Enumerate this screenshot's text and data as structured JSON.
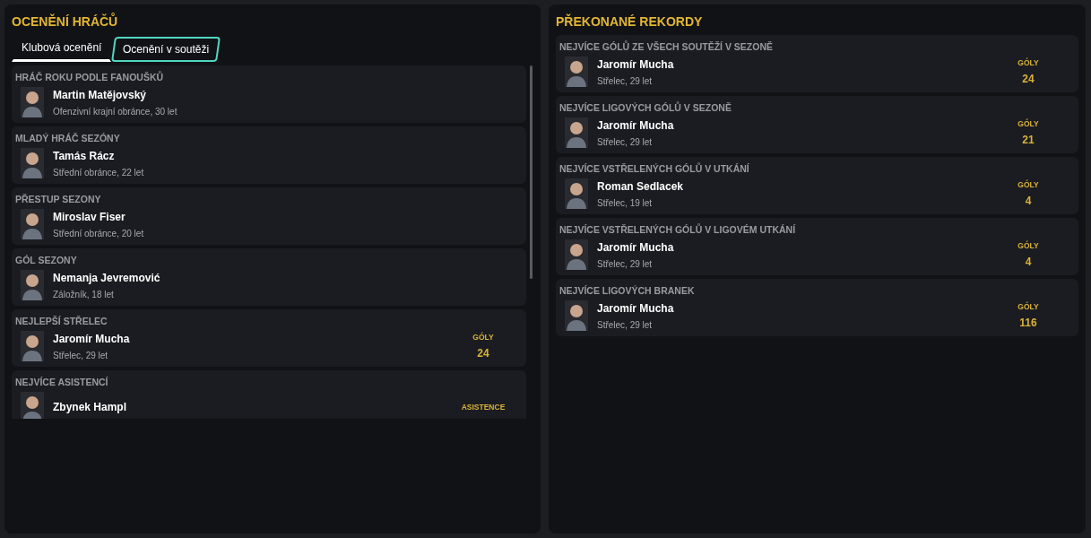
{
  "awards_panel": {
    "title": "OCENĚNÍ HRÁČŮ",
    "tabs": [
      {
        "label": "Klubová ocenění",
        "selected": true,
        "focused": false
      },
      {
        "label": "Ocenění v soutěži",
        "selected": false,
        "focused": true
      }
    ],
    "awards": [
      {
        "title": "HRÁČ ROKU PODLE FANOUŠKŮ",
        "name": "Martin Matějovský",
        "info": "Ofenzivní krajní obránce, 30 let"
      },
      {
        "title": "MLADÝ HRÁČ SEZÓNY",
        "name": "Tamás Rácz",
        "info": "Střední obránce, 22 let"
      },
      {
        "title": "PŘESTUP SEZONY",
        "name": "Miroslav Fiser",
        "info": "Střední obránce, 20 let"
      },
      {
        "title": "GÓL SEZONY",
        "name": "Nemanja Jevremović",
        "info": "Záložník, 18 let"
      },
      {
        "title": "NEJLEPŠÍ STŘELEC",
        "name": "Jaromír Mucha",
        "info": "Střelec, 29 let",
        "stat_label": "GÓLY",
        "stat_value": "24"
      },
      {
        "title": "NEJVÍCE ASISTENCÍ",
        "name": "Zbynek Hampl",
        "stat_label": "ASISTENCE"
      }
    ]
  },
  "records_panel": {
    "title": "PŘEKONANÉ REKORDY",
    "records": [
      {
        "title": "NEJVÍCE GÓLŮ ZE VŠECH SOUTĚŽÍ V SEZONĚ",
        "name": "Jaromír Mucha",
        "info": "Střelec, 29 let",
        "stat_label": "GÓLY",
        "stat_value": "24"
      },
      {
        "title": "NEJVÍCE LIGOVÝCH GÓLŮ V SEZONĚ",
        "name": "Jaromír Mucha",
        "info": "Střelec, 29 let",
        "stat_label": "GÓLY",
        "stat_value": "21"
      },
      {
        "title": "NEJVÍCE VSTŘELENÝCH GÓLŮ V UTKÁNÍ",
        "name": "Roman Sedlacek",
        "info": "Střelec, 19 let",
        "stat_label": "GÓLY",
        "stat_value": "4"
      },
      {
        "title": "NEJVÍCE VSTŘELENÝCH GÓLŮ V LIGOVÉM UTKÁNÍ",
        "name": "Jaromír Mucha",
        "info": "Střelec, 29 let",
        "stat_label": "GÓLY",
        "stat_value": "4"
      },
      {
        "title": "NEJVÍCE LIGOVÝCH BRANEK",
        "name": "Jaromír Mucha",
        "info": "Střelec, 29 let",
        "stat_label": "GÓLY",
        "stat_value": "116"
      }
    ]
  }
}
